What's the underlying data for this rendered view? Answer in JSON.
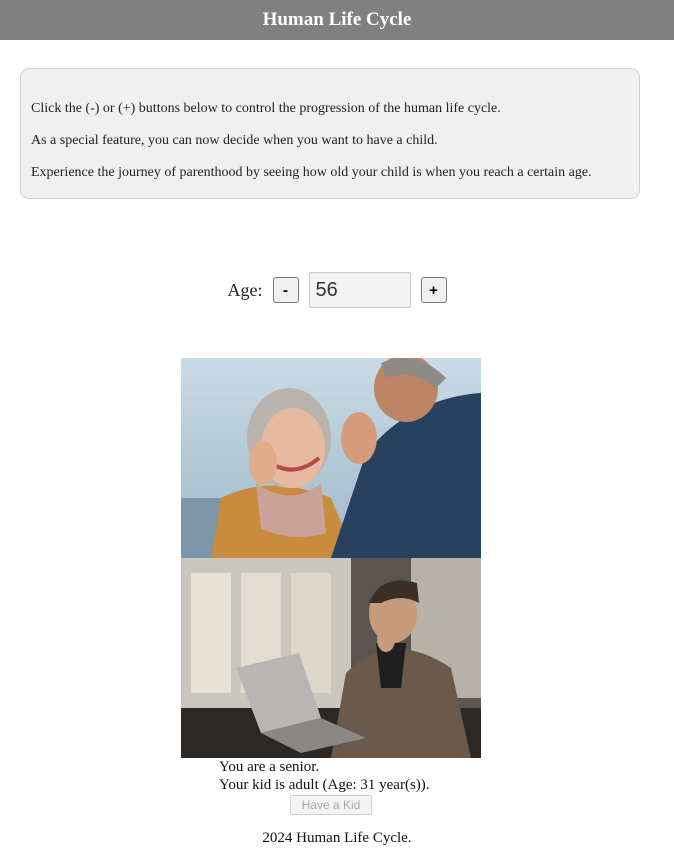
{
  "header": {
    "title": "Human Life Cycle"
  },
  "info": {
    "lines": [
      "Click the (-) or (+) buttons below to control the progression of the human life cycle.",
      "As a special feature, you can now decide when you want to have a child.",
      "Experience the journey of parenthood by seeing how old your child is when you reach a certain age."
    ]
  },
  "age_control": {
    "label": "Age:",
    "minus_label": "-",
    "plus_label": "+",
    "value": "56"
  },
  "status": {
    "self": "You are a senior.",
    "kid": "Your kid is adult (Age: 31 year(s))."
  },
  "kid_button": {
    "label": "Have a Kid",
    "disabled": true
  },
  "footer": {
    "text": "2024 Human Life Cycle."
  },
  "colors": {
    "header_bg": "#808080",
    "info_bg": "#f0f0f0"
  }
}
